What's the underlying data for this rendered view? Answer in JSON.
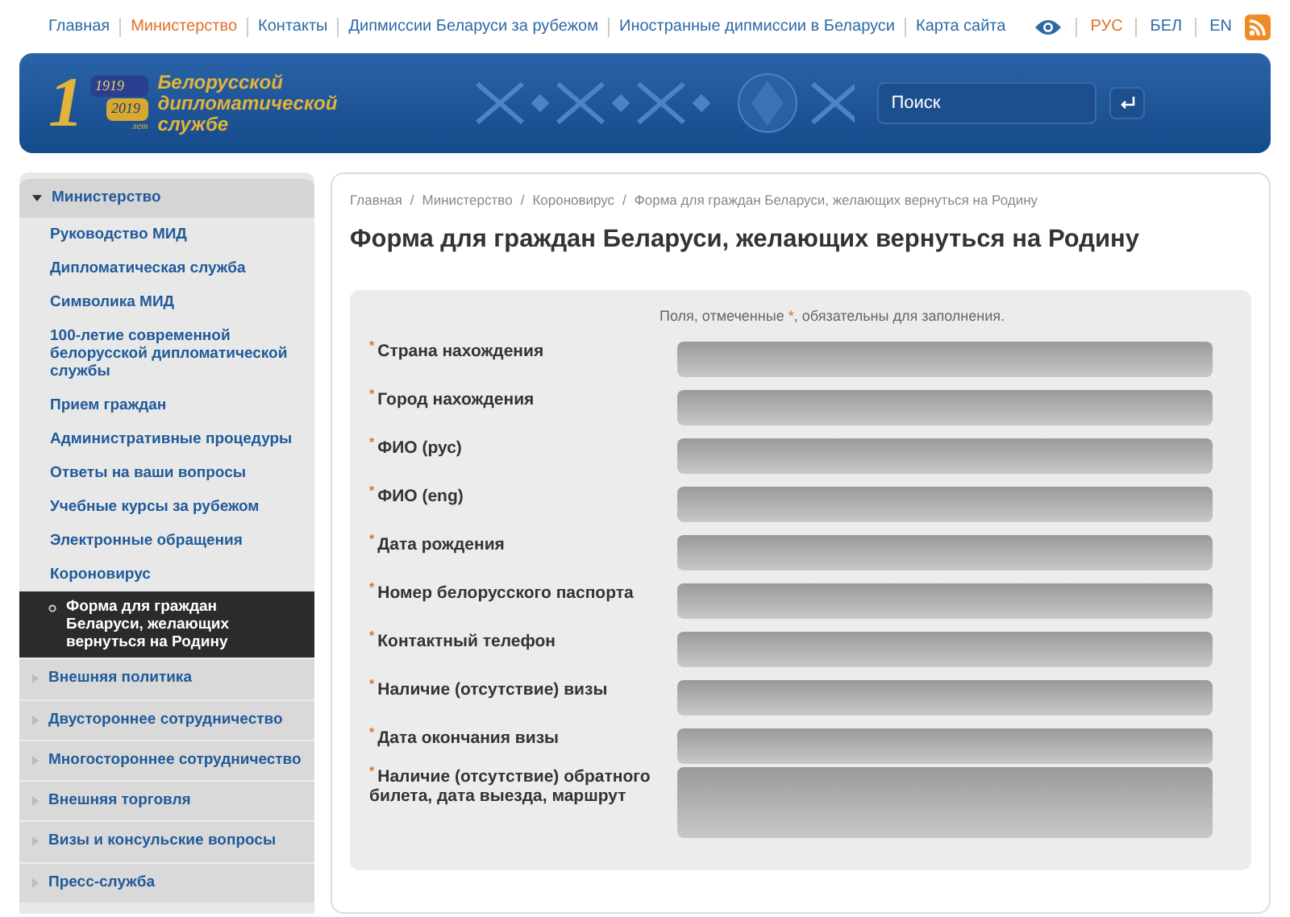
{
  "top_nav": [
    {
      "label": "Главная",
      "selected": false
    },
    {
      "label": "Министерство",
      "selected": true
    },
    {
      "label": "Контакты",
      "selected": false
    },
    {
      "label": "Дипмиссии Беларуси за рубежом",
      "selected": false
    },
    {
      "label": "Иностранные дипмиссии в Беларуси",
      "selected": false
    },
    {
      "label": "Карта сайта",
      "selected": false
    }
  ],
  "languages": [
    {
      "label": "РУС",
      "selected": true
    },
    {
      "label": "БЕЛ",
      "selected": false
    },
    {
      "label": "EN",
      "selected": false
    }
  ],
  "header": {
    "logo_digit": "1",
    "logo_years": [
      "1919",
      "2019"
    ],
    "logo_years_suffix": "лет",
    "tagline": "Белорусской дипломатической службе",
    "search": {
      "placeholder": "Поиск"
    }
  },
  "sidebar": {
    "items": [
      {
        "label": "Министерство",
        "expanded": true,
        "children": [
          {
            "label": "Руководство МИД",
            "selected": false
          },
          {
            "label": "Дипломатическая служба",
            "selected": false
          },
          {
            "label": "Символика МИД",
            "selected": false
          },
          {
            "label": "100-летие современной белорусской дипломатической службы",
            "selected": false
          },
          {
            "label": "Прием граждан",
            "selected": false
          },
          {
            "label": "Административные процедуры",
            "selected": false
          },
          {
            "label": "Ответы на ваши вопросы",
            "selected": false
          },
          {
            "label": "Учебные курсы за рубежом",
            "selected": false
          },
          {
            "label": "Электронные обращения",
            "selected": false
          },
          {
            "label": "Короновирус",
            "selected": false,
            "children": [
              {
                "label": "Форма для граждан Беларуси, желающих вернуться на Родину",
                "selected": true
              }
            ]
          }
        ]
      },
      {
        "label": "Внешняя политика",
        "expanded": false
      },
      {
        "label": "Двустороннее сотрудничество",
        "expanded": false
      },
      {
        "label": "Многостороннее сотрудничество",
        "expanded": false
      },
      {
        "label": "Внешняя торговля",
        "expanded": false
      },
      {
        "label": "Визы и консульские вопросы",
        "expanded": false
      },
      {
        "label": "Пресс-служба",
        "expanded": false
      }
    ]
  },
  "breadcrumbs": [
    "Главная",
    "Министерство",
    "Короновирус",
    "Форма для граждан Беларуси, желающих вернуться на Родину"
  ],
  "breadcrumb_separator": "/",
  "title": "Форма для граждан Беларуси, желающих вернуться на Родину",
  "form": {
    "note_before": "Поля, отмеченные ",
    "note_mark": "*",
    "note_after": ", обязательны для заполнения.",
    "fields": [
      {
        "label": "Страна нахождения",
        "required_mark": "*",
        "kind": "text"
      },
      {
        "label": "Город нахождения",
        "required_mark": "*",
        "kind": "text"
      },
      {
        "label": "ФИО (рус)",
        "required_mark": "*",
        "kind": "text"
      },
      {
        "label": "ФИО (eng)",
        "required_mark": "*",
        "kind": "text"
      },
      {
        "label": "Дата рождения",
        "required_mark": "*",
        "kind": "text"
      },
      {
        "label": "Номер белорусского паспорта",
        "required_mark": "*",
        "kind": "text"
      },
      {
        "label": "Контактный телефон",
        "required_mark": "*",
        "kind": "text"
      },
      {
        "label": "Наличие (отсутствие) визы",
        "required_mark": "*",
        "kind": "text"
      },
      {
        "label": "Дата окончания визы",
        "required_mark": "*",
        "kind": "text"
      },
      {
        "label": "Наличие (отсутствие) обратного билета, дата выезда, маршрут",
        "required_mark": "*",
        "kind": "textarea"
      }
    ]
  }
}
